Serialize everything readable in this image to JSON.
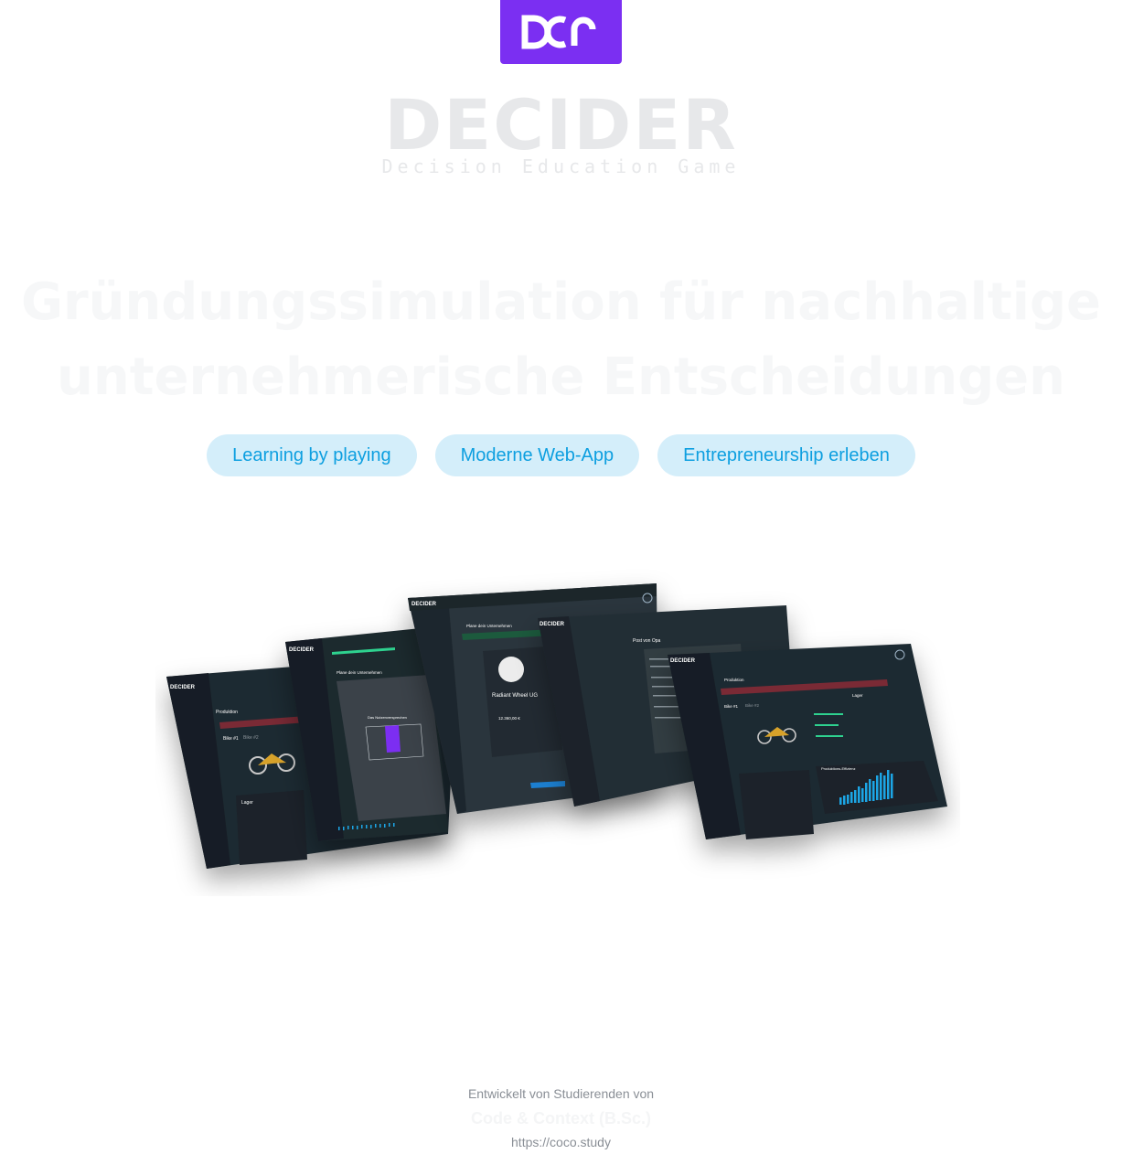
{
  "logo": {
    "icon": "dcr-logo-icon",
    "accent": "#7b2ff2"
  },
  "brand": {
    "name": "DECIDER",
    "tagline": "Decision Education Game"
  },
  "headline": {
    "line1": "Gründungssimulation für nachhaltige",
    "line2": "unternehmerische Entscheidungen"
  },
  "pills": [
    {
      "label": "Learning by playing"
    },
    {
      "label": "Moderne Web-App"
    },
    {
      "label": "Entrepreneurship erleben"
    }
  ],
  "pill_colors": {
    "background": "#d4eefa",
    "text": "#0d9fe0"
  },
  "screens": {
    "brand": "DECIDER",
    "screen_1": {
      "title": "Produktion",
      "tab1": "Bike #1",
      "tab2": "Bike #2",
      "section": "Lager"
    },
    "screen_2": {
      "title": "Plane dein Unternehmen",
      "section": "Das Nutzenversprechen"
    },
    "screen_3": {
      "title": "Plane dein Unternehmen",
      "company": "Radiant Wheel UG",
      "amount": "12.360,00 €"
    },
    "screen_4": {
      "title": "Post von Opa"
    },
    "screen_5": {
      "title": "Produktion",
      "tab1": "Bike #1",
      "tab2": "Bike #2",
      "section1": "Lager",
      "section2": "Produktions-Effizienz"
    }
  },
  "footer": {
    "line1": "Entwickelt von Studierenden von",
    "line2": "Code & Context (B.Sc.)",
    "line3": "https://coco.study"
  }
}
